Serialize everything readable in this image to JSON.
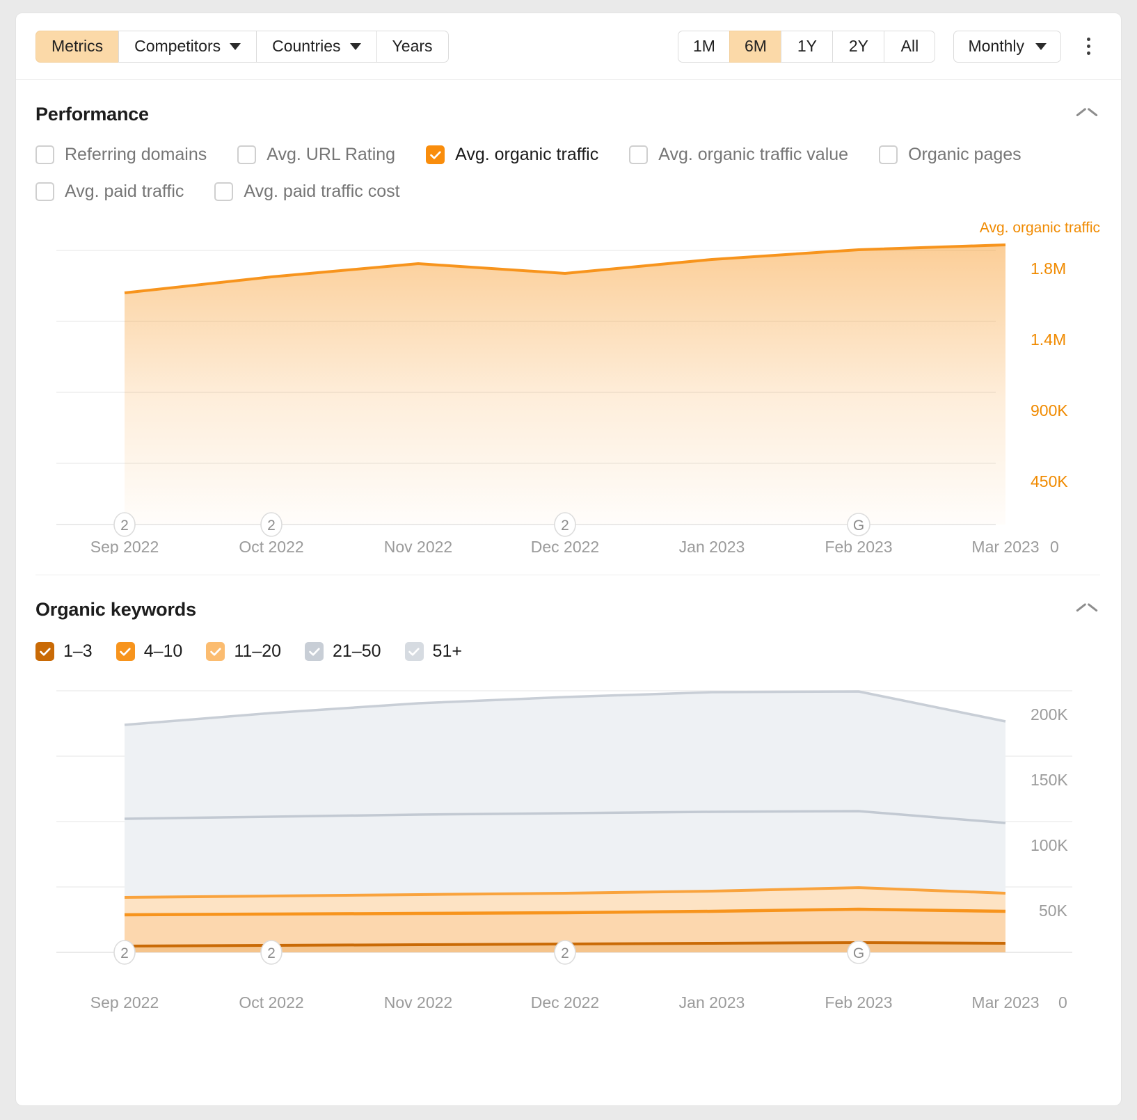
{
  "toolbar": {
    "tabs": [
      {
        "label": "Metrics",
        "active": true,
        "caret": false
      },
      {
        "label": "Competitors",
        "active": false,
        "caret": true
      },
      {
        "label": "Countries",
        "active": false,
        "caret": true
      },
      {
        "label": "Years",
        "active": false,
        "caret": false
      }
    ],
    "periods": [
      {
        "label": "1M",
        "active": false
      },
      {
        "label": "6M",
        "active": true
      },
      {
        "label": "1Y",
        "active": false
      },
      {
        "label": "2Y",
        "active": false
      },
      {
        "label": "All",
        "active": false
      }
    ],
    "frequency": "Monthly",
    "menu_icon": "kebab-menu-icon"
  },
  "performance": {
    "title": "Performance",
    "collapse_icon": "chevron-up-icon",
    "metrics": [
      {
        "label": "Referring domains",
        "checked": false
      },
      {
        "label": "Avg. URL Rating",
        "checked": false
      },
      {
        "label": "Avg. organic traffic",
        "checked": true
      },
      {
        "label": "Avg. organic traffic value",
        "checked": false
      },
      {
        "label": "Organic pages",
        "checked": false
      },
      {
        "label": "Avg. paid traffic",
        "checked": false
      },
      {
        "label": "Avg. paid traffic cost",
        "checked": false
      }
    ],
    "series_label": "Avg. organic traffic",
    "accent_color": "#f7941d"
  },
  "keywords": {
    "title": "Organic keywords",
    "collapse_icon": "chevron-up-icon",
    "buckets": [
      {
        "label": "1–3",
        "checked": true,
        "color": "#c96a06"
      },
      {
        "label": "4–10",
        "checked": true,
        "color": "#f7941d"
      },
      {
        "label": "11–20",
        "checked": true,
        "color": "#fbbc70"
      },
      {
        "label": "21–50",
        "checked": true,
        "color": "#c8ced6"
      },
      {
        "label": "51+",
        "checked": true,
        "color": "#d6dbe1"
      }
    ]
  },
  "chart_data": [
    {
      "type": "area",
      "title": "Avg. organic traffic",
      "xlabel": "",
      "ylabel": "",
      "grid": true,
      "legend_position": "top-right",
      "categories": [
        "Sep 2022",
        "Oct 2022",
        "Nov 2022",
        "Dec 2022",
        "Jan 2023",
        "Feb 2023",
        "Mar 2023"
      ],
      "ytick_labels": [
        "1.8M",
        "1.4M",
        "900K",
        "450K",
        "0"
      ],
      "ytick_values": [
        1800000,
        1400000,
        900000,
        450000,
        0
      ],
      "ylim": [
        0,
        2050000
      ],
      "series": [
        {
          "name": "Avg. organic traffic",
          "color": "#f7941d",
          "values": [
            1740000,
            1830000,
            1885000,
            1845000,
            1905000,
            1945000,
            1965000
          ]
        }
      ],
      "annotations": [
        {
          "x": "Sep 2022",
          "marker": "2",
          "type": "update-badge"
        },
        {
          "x": "Oct 2022",
          "marker": "2",
          "type": "update-badge"
        },
        {
          "x": "Dec 2022",
          "marker": "2",
          "type": "update-badge"
        },
        {
          "x": "Feb 2023",
          "marker": "G",
          "type": "google-update-badge"
        }
      ]
    },
    {
      "type": "area",
      "title": "Organic keywords",
      "xlabel": "",
      "ylabel": "",
      "grid": true,
      "stacked": true,
      "categories": [
        "Sep 2022",
        "Oct 2022",
        "Nov 2022",
        "Dec 2022",
        "Jan 2023",
        "Feb 2023",
        "Mar 2023"
      ],
      "ytick_labels": [
        "200K",
        "150K",
        "100K",
        "50K",
        "0"
      ],
      "ytick_values": [
        200000,
        150000,
        100000,
        50000,
        0
      ],
      "ylim": [
        0,
        230000
      ],
      "series": [
        {
          "name": "1–3",
          "color": "#c96a06",
          "values": [
            3500,
            3700,
            3900,
            4000,
            4200,
            4400,
            4300
          ]
        },
        {
          "name": "4–10",
          "color": "#f7941d",
          "values": [
            26000,
            26500,
            27000,
            27500,
            28500,
            30000,
            29500
          ]
        },
        {
          "name": "11–20",
          "color": "#fbbc70",
          "values": [
            13000,
            13200,
            13500,
            13800,
            14200,
            15000,
            14500
          ]
        },
        {
          "name": "21–50",
          "color": "#c8ced6",
          "values": [
            60000,
            62000,
            63500,
            64500,
            65500,
            66000,
            58000
          ]
        },
        {
          "name": "51+",
          "color": "#d6dbe1",
          "values": [
            72000,
            80000,
            88000,
            95000,
            101000,
            102000,
            78000
          ]
        }
      ],
      "annotations": [
        {
          "x": "Sep 2022",
          "marker": "2",
          "type": "update-badge"
        },
        {
          "x": "Oct 2022",
          "marker": "2",
          "type": "update-badge"
        },
        {
          "x": "Dec 2022",
          "marker": "2",
          "type": "update-badge"
        },
        {
          "x": "Feb 2023",
          "marker": "G",
          "type": "google-update-badge"
        }
      ]
    }
  ]
}
